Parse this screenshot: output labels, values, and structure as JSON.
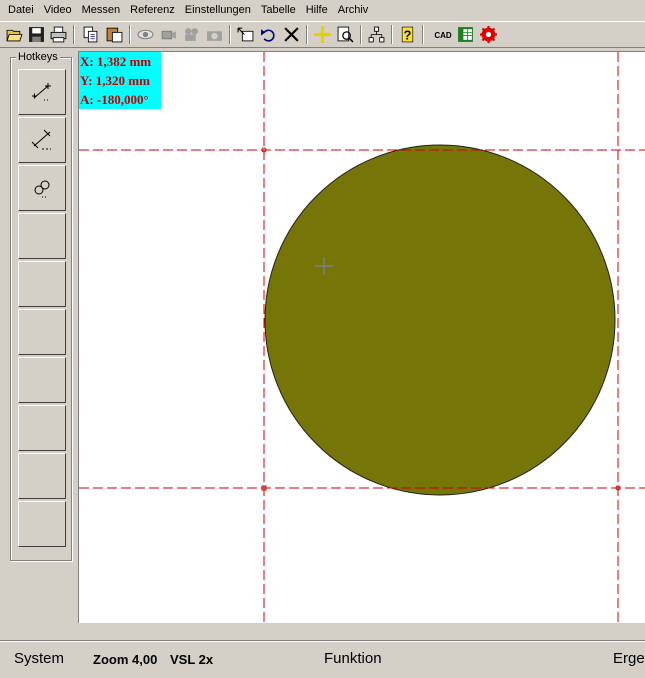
{
  "menu": [
    "Datei",
    "Video",
    "Messen",
    "Referenz",
    "Einstellungen",
    "Tabelle",
    "Hilfe",
    "Archiv"
  ],
  "hotkeys": {
    "title": "Hotkeys"
  },
  "readout": {
    "x": "X: 1,382 mm",
    "y": "Y: 1,320 mm",
    "a": "A: -180,000°"
  },
  "toolbar_cad_label": "CAD",
  "status": {
    "system": "System",
    "zoom": "Zoom 4,00",
    "vsl": "VSL 2x",
    "funktion": "Funktion",
    "ergebnis": "Erge"
  },
  "colors": {
    "circle_fill": "#767608",
    "reference_line": "#d00000",
    "readout_bg": "#00ffff",
    "readout_text": "#c00000"
  }
}
